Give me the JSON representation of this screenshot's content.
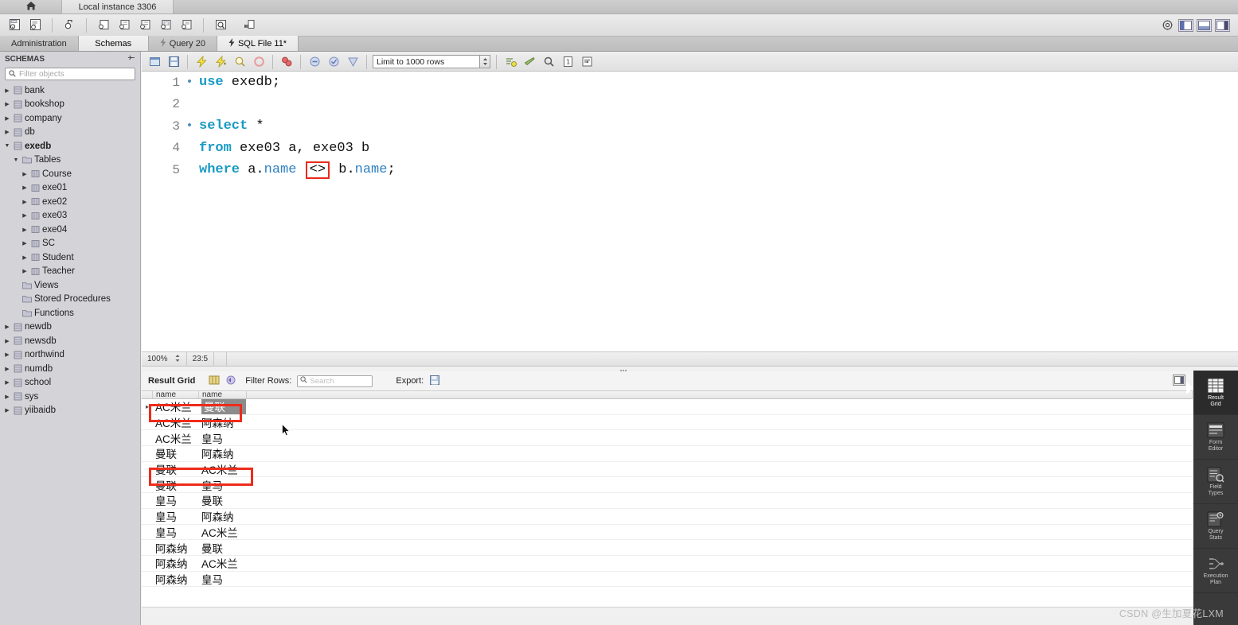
{
  "window": {
    "home_tab_icon": "home-icon",
    "instance_tab": "Local instance 3306"
  },
  "main_toolbar": {
    "icons": [
      "new-schema-icon",
      "open-sql-script-icon",
      "open-connection-icon",
      "new-query-tab-icon",
      "new-connection-icon",
      "edit-connection-icon",
      "manage-connections-icon",
      "server-status-icon",
      "search-icon",
      "reconnect-icon"
    ],
    "right_icons": [
      "gear-icon",
      "toggle-sidebar-icon",
      "toggle-output-icon",
      "toggle-secondary-sidebar-icon"
    ]
  },
  "section_tabs": [
    {
      "label": "Administration",
      "selected": false,
      "icon": ""
    },
    {
      "label": "Schemas",
      "selected": true,
      "icon": ""
    },
    {
      "label": "Query 20",
      "selected": false,
      "icon": "lightning-icon"
    },
    {
      "label": "SQL File 11*",
      "selected": true,
      "icon": "lightning-icon"
    }
  ],
  "sidebar": {
    "title": "SCHEMAS",
    "collapse_icon": "collapse-all-icon",
    "search_placeholder": "Filter objects",
    "search_value": "",
    "search_icon": "search-icon",
    "tree": [
      {
        "label": "bank",
        "indent": 0,
        "arrow": "collapsed",
        "icon": "schema-icon",
        "bold": false
      },
      {
        "label": "bookshop",
        "indent": 0,
        "arrow": "collapsed",
        "icon": "schema-icon",
        "bold": false
      },
      {
        "label": "company",
        "indent": 0,
        "arrow": "collapsed",
        "icon": "schema-icon",
        "bold": false
      },
      {
        "label": "db",
        "indent": 0,
        "arrow": "collapsed",
        "icon": "schema-icon",
        "bold": false
      },
      {
        "label": "exedb",
        "indent": 0,
        "arrow": "expanded",
        "icon": "schema-icon",
        "bold": true
      },
      {
        "label": "Tables",
        "indent": 1,
        "arrow": "expanded",
        "icon": "folder-icon",
        "bold": false
      },
      {
        "label": "Course",
        "indent": 2,
        "arrow": "collapsed",
        "icon": "table-icon",
        "bold": false
      },
      {
        "label": "exe01",
        "indent": 2,
        "arrow": "collapsed",
        "icon": "table-icon",
        "bold": false
      },
      {
        "label": "exe02",
        "indent": 2,
        "arrow": "collapsed",
        "icon": "table-icon",
        "bold": false
      },
      {
        "label": "exe03",
        "indent": 2,
        "arrow": "collapsed",
        "icon": "table-icon",
        "bold": false
      },
      {
        "label": "exe04",
        "indent": 2,
        "arrow": "collapsed",
        "icon": "table-icon",
        "bold": false
      },
      {
        "label": "SC",
        "indent": 2,
        "arrow": "collapsed",
        "icon": "table-icon",
        "bold": false
      },
      {
        "label": "Student",
        "indent": 2,
        "arrow": "collapsed",
        "icon": "table-icon",
        "bold": false
      },
      {
        "label": "Teacher",
        "indent": 2,
        "arrow": "collapsed",
        "icon": "table-icon",
        "bold": false
      },
      {
        "label": "Views",
        "indent": 1,
        "arrow": "none",
        "icon": "folder-icon",
        "bold": false
      },
      {
        "label": "Stored Procedures",
        "indent": 1,
        "arrow": "none",
        "icon": "folder-icon",
        "bold": false
      },
      {
        "label": "Functions",
        "indent": 1,
        "arrow": "none",
        "icon": "folder-icon",
        "bold": false
      },
      {
        "label": "newdb",
        "indent": 0,
        "arrow": "collapsed",
        "icon": "schema-icon",
        "bold": false
      },
      {
        "label": "newsdb",
        "indent": 0,
        "arrow": "collapsed",
        "icon": "schema-icon",
        "bold": false
      },
      {
        "label": "northwind",
        "indent": 0,
        "arrow": "collapsed",
        "icon": "schema-icon",
        "bold": false
      },
      {
        "label": "numdb",
        "indent": 0,
        "arrow": "collapsed",
        "icon": "schema-icon",
        "bold": false
      },
      {
        "label": "school",
        "indent": 0,
        "arrow": "collapsed",
        "icon": "schema-icon",
        "bold": false
      },
      {
        "label": "sys",
        "indent": 0,
        "arrow": "collapsed",
        "icon": "schema-icon",
        "bold": false
      },
      {
        "label": "yiibaidb",
        "indent": 0,
        "arrow": "collapsed",
        "icon": "schema-icon",
        "bold": false
      }
    ]
  },
  "editor_toolbar": {
    "icons": [
      "open-script-icon",
      "save-script-icon",
      "execute-icon",
      "execute-current-icon",
      "explain-icon",
      "stop-icon",
      "toggle-breakpoint-icon",
      "stop-on-error-icon",
      "commit-icon",
      "rollback-icon"
    ],
    "limit_label": "Limit to 1000 rows",
    "limit_spinner_icon": "spinner-icon",
    "right_icons": [
      "autocomplete-icon",
      "beautify-icon",
      "find-icon",
      "invisible-chars-icon",
      "wrap-lines-icon"
    ]
  },
  "editor": {
    "lines": [
      {
        "num": "1",
        "marked": true,
        "tokens": [
          {
            "t": "use",
            "c": "kw"
          },
          {
            "t": " exedb;",
            "c": "plain"
          }
        ]
      },
      {
        "num": "2",
        "marked": false,
        "tokens": []
      },
      {
        "num": "3",
        "marked": true,
        "tokens": [
          {
            "t": "select",
            "c": "kw"
          },
          {
            "t": " *",
            "c": "plain"
          }
        ]
      },
      {
        "num": "4",
        "marked": false,
        "tokens": [
          {
            "t": "from",
            "c": "kw"
          },
          {
            "t": " exe03 a, exe03 b",
            "c": "plain"
          }
        ]
      },
      {
        "num": "5",
        "marked": false,
        "tokens": [
          {
            "t": "where",
            "c": "kw"
          },
          {
            "t": " a.",
            "c": "plain"
          },
          {
            "t": "name",
            "c": "col"
          },
          {
            "t": " ",
            "c": "plain"
          },
          {
            "t": "<>",
            "c": "boxed"
          },
          {
            "t": " b.",
            "c": "plain"
          },
          {
            "t": "name",
            "c": "col"
          },
          {
            "t": ";",
            "c": "plain"
          }
        ]
      }
    ],
    "full_sql": "use exedb;\n\nselect *\nfrom exe03 a, exe03 b\nwhere a.name <> b.name;"
  },
  "editor_status": {
    "zoom": "100%",
    "cursor_position": "23:5"
  },
  "result_toolbar": {
    "title": "Result Grid",
    "grid_icon": "grid-icon",
    "refresh_icon": "refresh-icon",
    "filter_label": "Filter Rows:",
    "filter_placeholder": "Search",
    "filter_value": "",
    "filter_icon": "search-icon",
    "export_label": "Export:",
    "export_icon": "export-icon"
  },
  "result_grid": {
    "columns": [
      "name",
      "name"
    ],
    "rows": [
      {
        "c1": "AC米兰",
        "c2": "曼联",
        "selected_cell": 2
      },
      {
        "c1": "AC米兰",
        "c2": "阿森纳",
        "selected_cell": 0
      },
      {
        "c1": "AC米兰",
        "c2": "皇马",
        "selected_cell": 0
      },
      {
        "c1": "曼联",
        "c2": "阿森纳",
        "selected_cell": 0
      },
      {
        "c1": "曼联",
        "c2": "AC米兰",
        "selected_cell": 0
      },
      {
        "c1": "曼联",
        "c2": "皇马",
        "selected_cell": 0
      },
      {
        "c1": "皇马",
        "c2": "曼联",
        "selected_cell": 0
      },
      {
        "c1": "皇马",
        "c2": "阿森纳",
        "selected_cell": 0
      },
      {
        "c1": "皇马",
        "c2": "AC米兰",
        "selected_cell": 0
      },
      {
        "c1": "阿森纳",
        "c2": "曼联",
        "selected_cell": 0
      },
      {
        "c1": "阿森纳",
        "c2": "AC米兰",
        "selected_cell": 0
      },
      {
        "c1": "阿森纳",
        "c2": "皇马",
        "selected_cell": 0
      }
    ],
    "row_marker": "▸"
  },
  "right_panel": {
    "items": [
      {
        "label": "Result\nGrid",
        "icon": "result-grid-icon",
        "selected": true
      },
      {
        "label": "Form\nEditor",
        "icon": "form-editor-icon",
        "selected": false
      },
      {
        "label": "Field\nTypes",
        "icon": "field-types-icon",
        "selected": false
      },
      {
        "label": "Query\nStats",
        "icon": "query-stats-icon",
        "selected": false
      },
      {
        "label": "Execution\nPlan",
        "icon": "execution-plan-icon",
        "selected": false
      }
    ]
  },
  "watermark": "CSDN @生加夏花LXM",
  "colors": {
    "accent_red": "#ee2b1b",
    "keyword_blue": "#1a9ac4",
    "column_blue": "#2f7fbf",
    "selection_gray": "#8c8c8c",
    "panel_dark": "#3a3a3a"
  }
}
